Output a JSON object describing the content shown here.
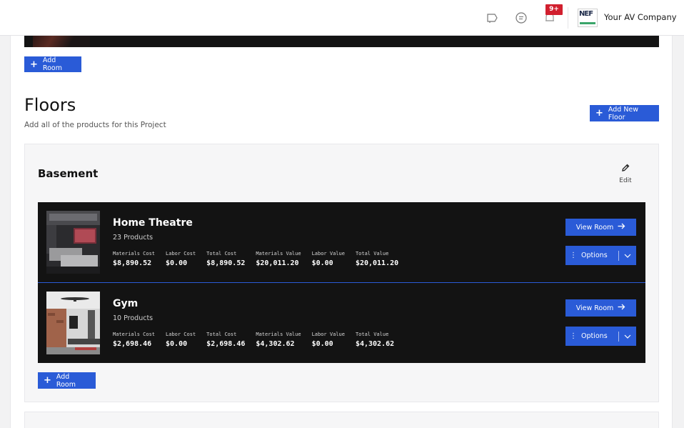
{
  "header": {
    "notification_badge": "9+",
    "company_logo_text": "NEF",
    "company_name": "Your AV Company",
    "icons": [
      "announcement-icon",
      "chat-icon",
      "bell-icon"
    ]
  },
  "top_add_room_label": "Add Room",
  "floors": {
    "title": "Floors",
    "subtitle": "Add all of the products for this Project",
    "add_floor_label": "Add New Floor"
  },
  "floor": {
    "name": "Basement",
    "edit_label": "Edit",
    "add_room_label": "Add Room",
    "rooms": [
      {
        "title": "Home Theatre",
        "products": "23 Products",
        "stats": [
          {
            "label": "Materials Cost",
            "value": "$8,890.52"
          },
          {
            "label": "Labor Cost",
            "value": "$0.00"
          },
          {
            "label": "Total Cost",
            "value": "$8,890.52"
          },
          {
            "label": "Materials Value",
            "value": "$20,011.20"
          },
          {
            "label": "Labor Value",
            "value": "$0.00"
          },
          {
            "label": "Total Value",
            "value": "$20,011.20"
          }
        ],
        "view_label": "View Room",
        "options_label": "Options"
      },
      {
        "title": "Gym",
        "products": "10 Products",
        "stats": [
          {
            "label": "Materials Cost",
            "value": "$2,698.46"
          },
          {
            "label": "Labor Cost",
            "value": "$0.00"
          },
          {
            "label": "Total Cost",
            "value": "$2,698.46"
          },
          {
            "label": "Materials Value",
            "value": "$4,302.62"
          },
          {
            "label": "Labor Value",
            "value": "$0.00"
          },
          {
            "label": "Total Value",
            "value": "$4,302.62"
          }
        ],
        "view_label": "View Room",
        "options_label": "Options"
      }
    ]
  },
  "colors": {
    "primary": "#2a5bd7",
    "room_card_bg": "#131313",
    "badge": "#d11f2e"
  }
}
